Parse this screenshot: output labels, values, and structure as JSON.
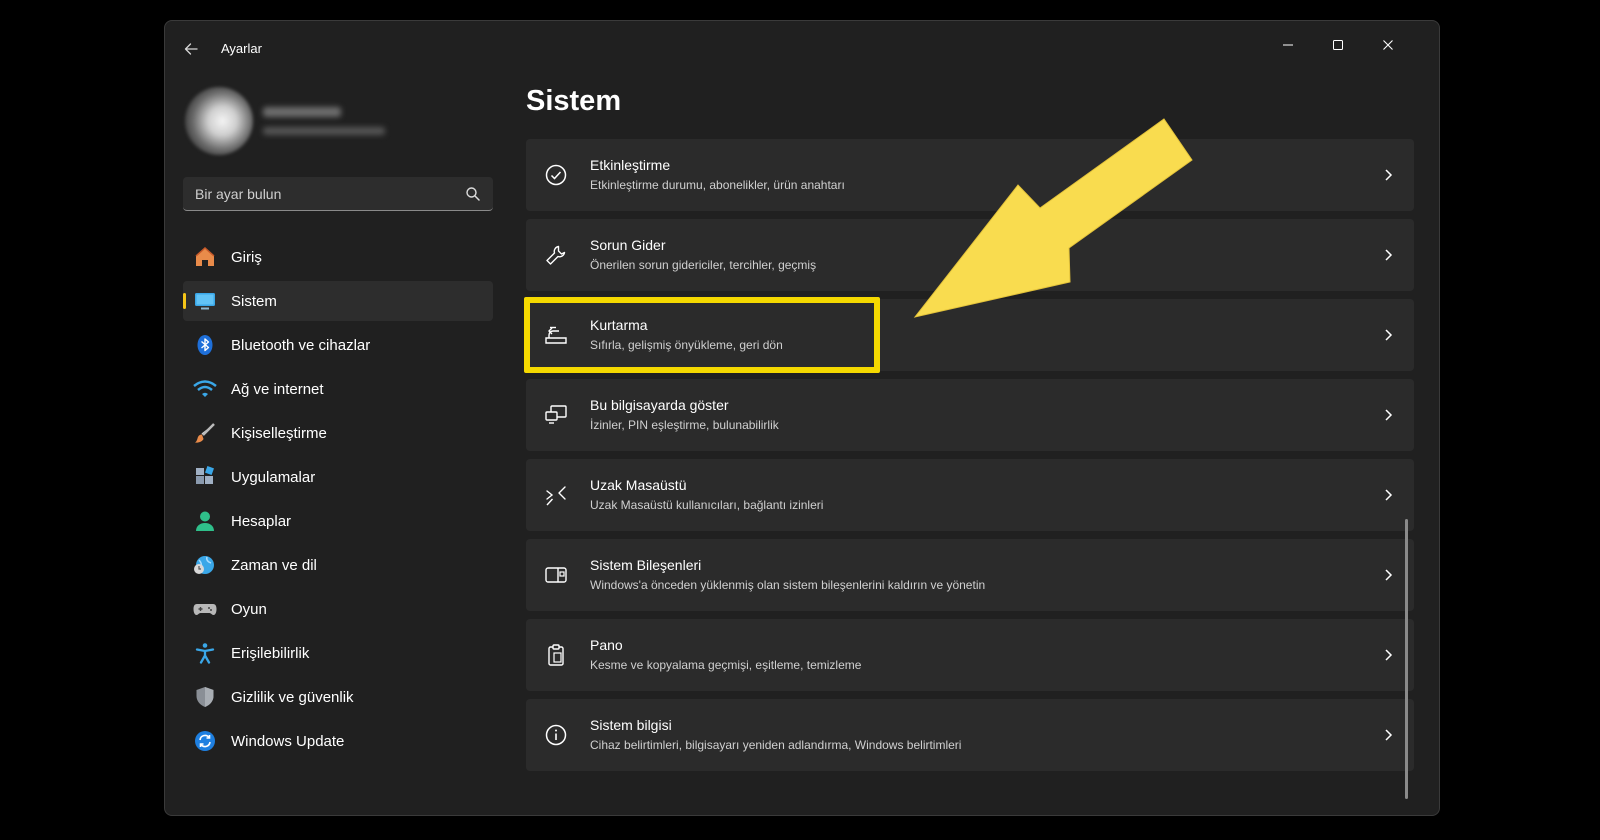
{
  "window": {
    "title": "Ayarlar"
  },
  "search": {
    "placeholder": "Bir ayar bulun"
  },
  "nav": {
    "items": [
      {
        "label": "Giriş",
        "icon": "home-icon"
      },
      {
        "label": "Sistem",
        "icon": "monitor-icon",
        "active": true
      },
      {
        "label": "Bluetooth ve cihazlar",
        "icon": "bluetooth-icon"
      },
      {
        "label": "Ağ ve internet",
        "icon": "wifi-icon"
      },
      {
        "label": "Kişiselleştirme",
        "icon": "brush-icon"
      },
      {
        "label": "Uygulamalar",
        "icon": "apps-icon"
      },
      {
        "label": "Hesaplar",
        "icon": "person-icon"
      },
      {
        "label": "Zaman ve dil",
        "icon": "globe-clock-icon"
      },
      {
        "label": "Oyun",
        "icon": "gamepad-icon"
      },
      {
        "label": "Erişilebilirlik",
        "icon": "accessibility-icon"
      },
      {
        "label": "Gizlilik ve güvenlik",
        "icon": "shield-icon"
      },
      {
        "label": "Windows Update",
        "icon": "update-icon"
      }
    ]
  },
  "main": {
    "title": "Sistem",
    "cards": [
      {
        "title": "Etkinleştirme",
        "subtitle": "Etkinleştirme durumu, abonelikler, ürün anahtarı",
        "icon": "check-circle-icon"
      },
      {
        "title": "Sorun Gider",
        "subtitle": "Önerilen sorun gidericiler, tercihler, geçmiş",
        "icon": "wrench-icon"
      },
      {
        "title": "Kurtarma",
        "subtitle": "Sıfırla, gelişmiş önyükleme, geri dön",
        "icon": "recovery-icon",
        "highlighted": true
      },
      {
        "title": "Bu bilgisayarda göster",
        "subtitle": "İzinler, PIN eşleştirme, bulunabilirlik",
        "icon": "project-icon"
      },
      {
        "title": "Uzak Masaüstü",
        "subtitle": "Uzak Masaüstü kullanıcıları, bağlantı izinleri",
        "icon": "remote-desktop-icon"
      },
      {
        "title": "Sistem Bileşenleri",
        "subtitle": "Windows'a önceden yüklenmiş olan sistem bileşenlerini kaldırın ve yönetin",
        "icon": "components-icon"
      },
      {
        "title": "Pano",
        "subtitle": "Kesme ve kopyalama geçmişi, eşitleme, temizleme",
        "icon": "clipboard-icon"
      },
      {
        "title": "Sistem bilgisi",
        "subtitle": "Cihaz belirtimleri, bilgisayarı yeniden adlandırma, Windows belirtimleri",
        "icon": "info-icon"
      }
    ]
  },
  "colors": {
    "accent": "#f5c518",
    "highlight": "#f5d900",
    "arrow": "#f9dc4f"
  }
}
